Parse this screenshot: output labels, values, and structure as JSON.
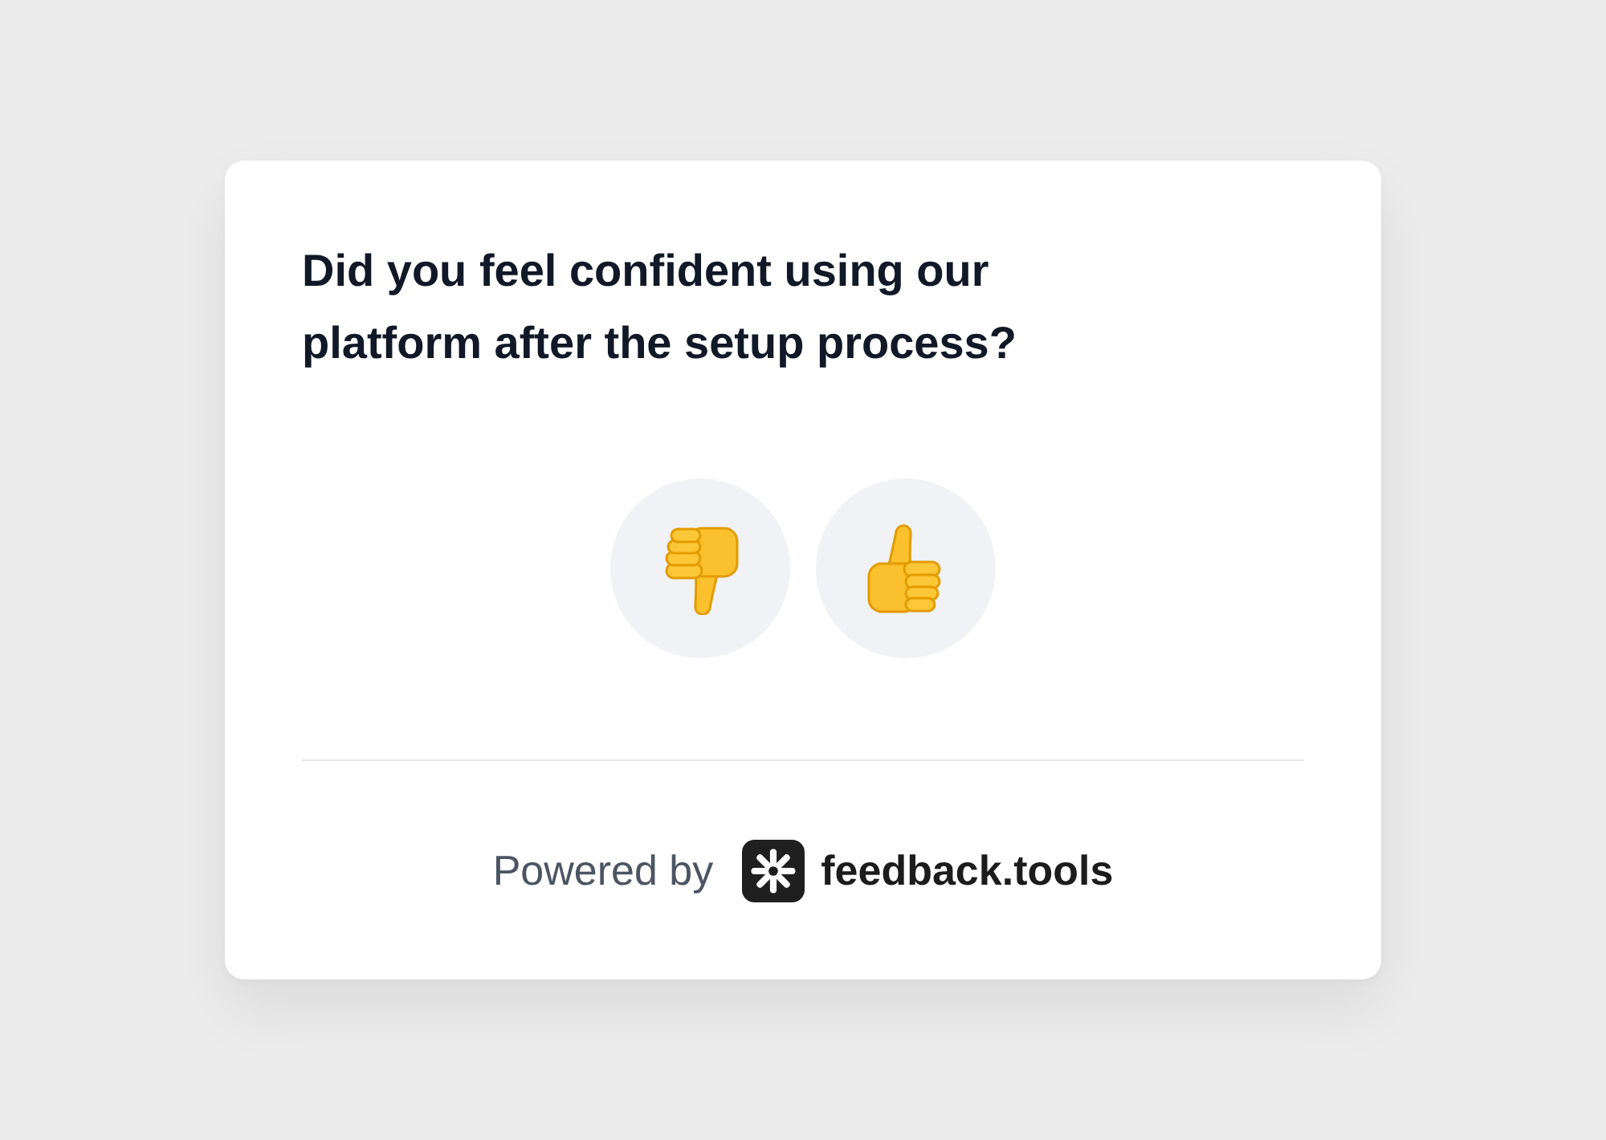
{
  "card": {
    "question": "Did you feel confident using our platform after the setup process?",
    "options": [
      {
        "kind": "thumbs_down",
        "selected": false
      },
      {
        "kind": "thumbs_up",
        "selected": false
      }
    ],
    "footer": {
      "prefix": "Powered by",
      "brand": "feedback.tools"
    }
  }
}
